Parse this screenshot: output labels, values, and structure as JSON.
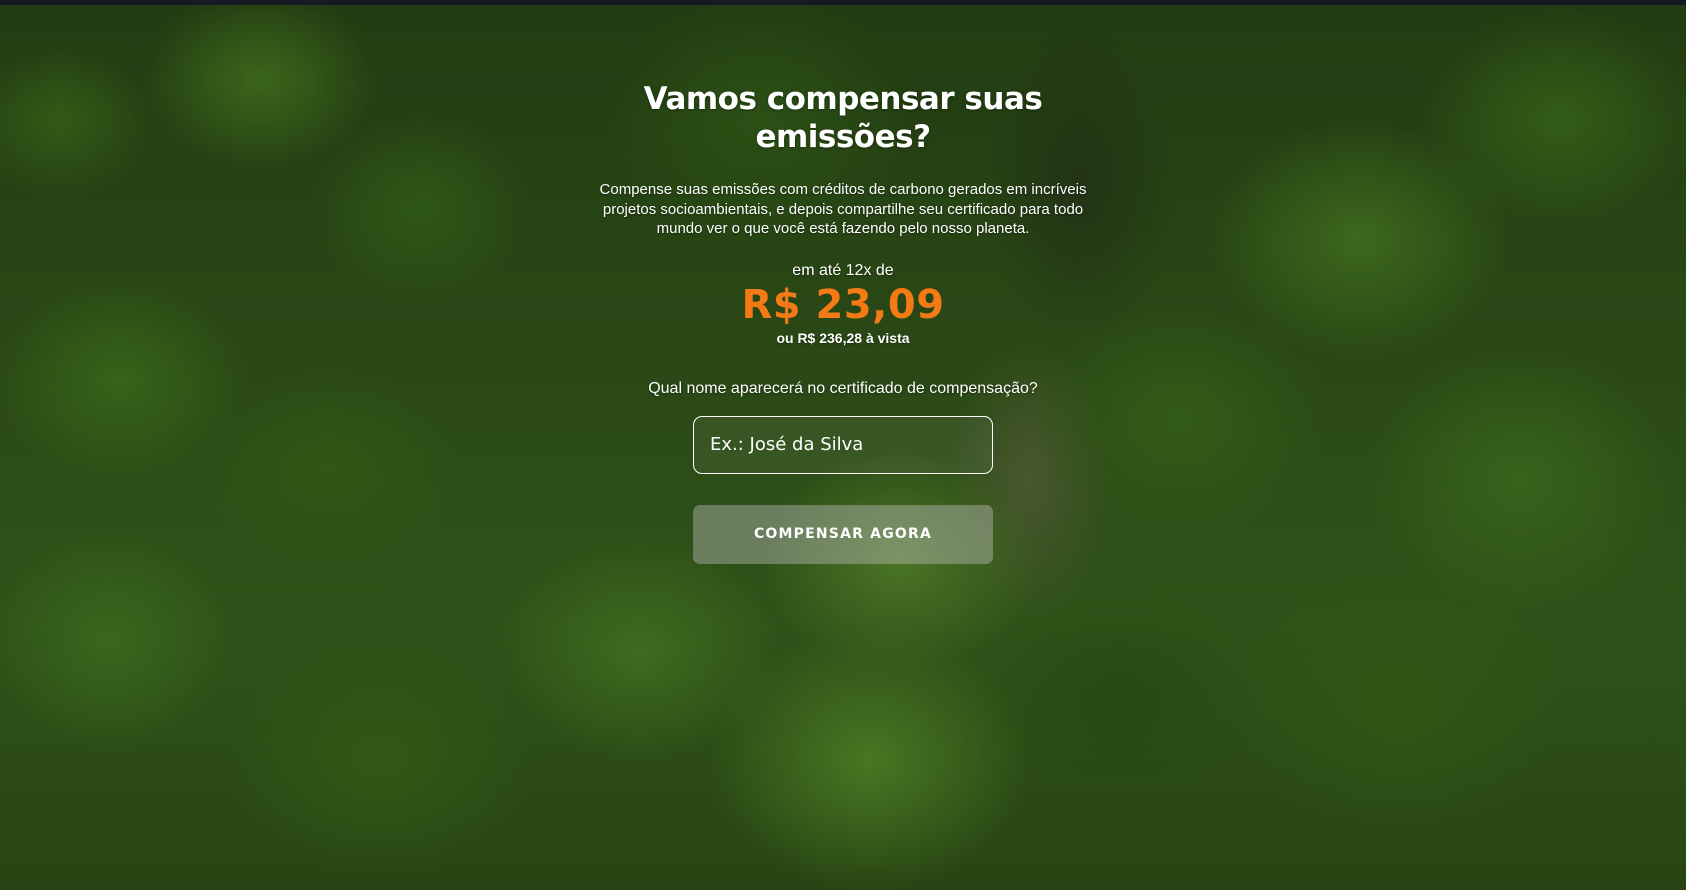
{
  "hero": {
    "title": "Vamos compensar suas emissões?",
    "description": "Compense suas emissões com créditos de carbono gerados em incríveis projetos socioambientais, e depois compartilhe seu certificado para todo mundo ver o que você está fazendo pelo nosso planeta."
  },
  "pricing": {
    "installment_label": "em até 12x de",
    "installment_price": "R$ 23,09",
    "cash_price": "ou R$ 236,28 à vista"
  },
  "form": {
    "question": "Qual nome aparecerá no certificado de compensação?",
    "name_input": {
      "value": "",
      "placeholder": "Ex.: José da Silva"
    },
    "submit_label": "COMPENSAR AGORA"
  },
  "colors": {
    "accent_price": "#f37a14",
    "text": "#ffffff",
    "button_background": "rgba(190,190,190,0.42)"
  },
  "background": {
    "image": "aerial-forest-photo"
  }
}
